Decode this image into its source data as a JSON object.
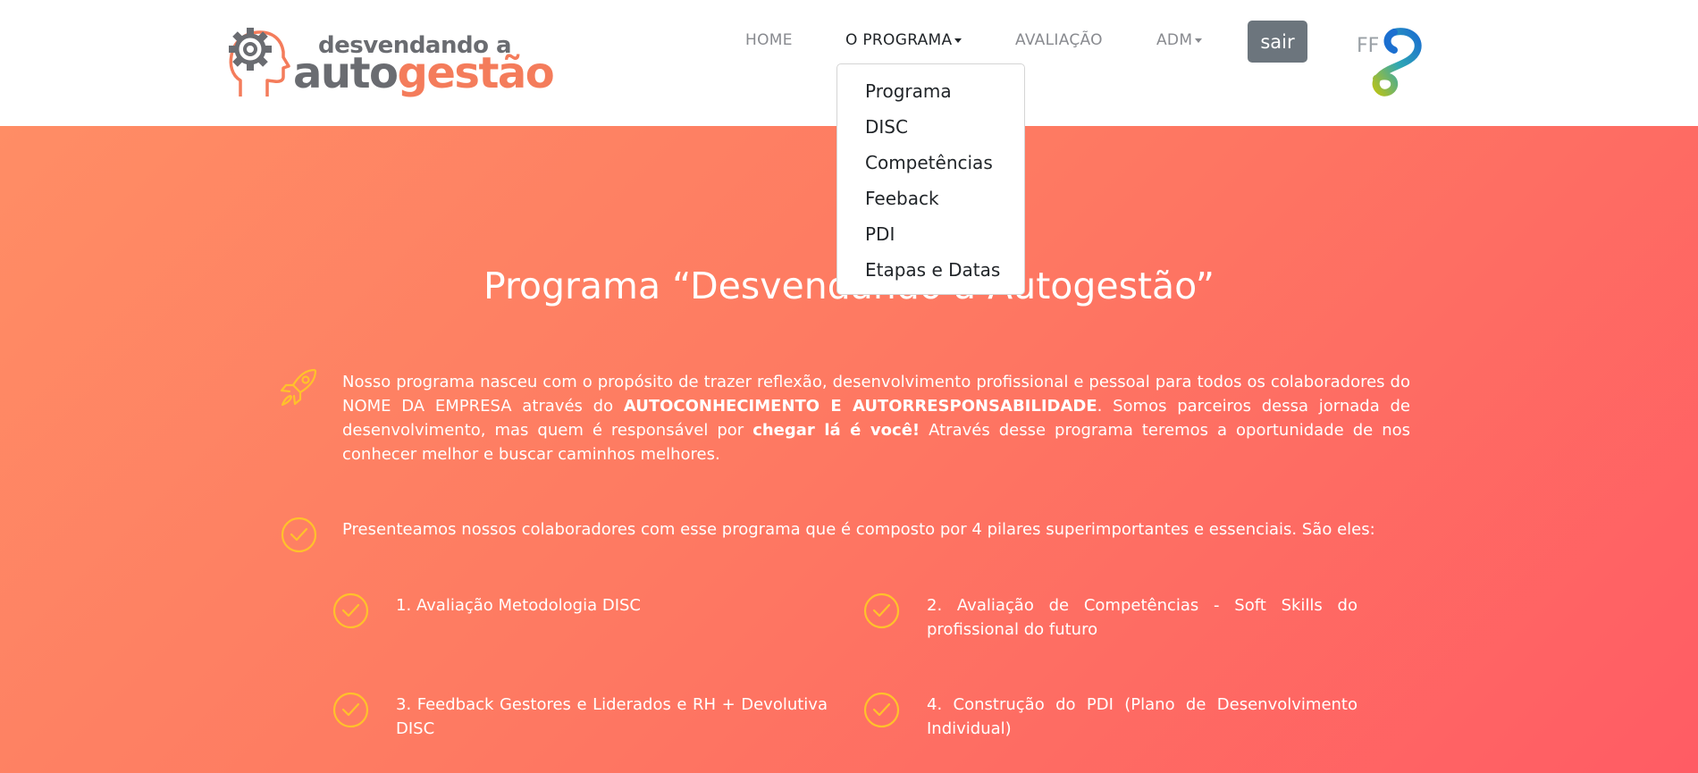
{
  "brand": {
    "line1": "desvendando a",
    "line2_a": "auto",
    "line2_b": "gestão",
    "partner_text": "FF"
  },
  "nav": {
    "home": "HOME",
    "programa": "O PROGRAMA",
    "avaliacao": "AVALIAÇÃO",
    "adm": "ADM",
    "logout": "sair"
  },
  "dropdown": {
    "items": [
      "Programa",
      "DISC",
      "Competências",
      "Feeback",
      "PDI",
      "Etapas e Datas"
    ]
  },
  "main": {
    "title": "Programa “Desvendando a Autogestão”",
    "intro_1": "Nosso programa nasceu com o propósito de trazer reflexão, desenvolvimento profissional e pessoal para todos os colaboradores do NOME DA EMPRESA através do ",
    "intro_bold_1": "AUTOCONHECIMENTO E AUTORRESPONSABILIDADE",
    "intro_2": ". Somos parceiros dessa jornada de desenvolvimento, mas quem é responsável por ",
    "intro_bold_2": "chegar lá é você!",
    "intro_3": " Através desse programa teremos a oportunidade de nos conhecer melhor e buscar caminhos melhores.",
    "pillars_intro": "Presenteamos nossos colaboradores com esse programa que é composto por 4 pilares superimportantes e essenciais. São eles:",
    "pillars": [
      "1. Avaliação Metodologia DISC",
      "2. Avaliação de Competências - Soft Skills do profissional do futuro",
      "3. Feedback Gestores e Liderados e RH + Devolutiva DISC",
      "4. Construção do PDI (Plano de Desenvolvimento Individual)"
    ]
  },
  "colors": {
    "accent_yellow": "#ffc12b",
    "brand_orange": "#f47c5b",
    "brand_gray": "#6a6c71",
    "button_gray": "#6c757d"
  }
}
